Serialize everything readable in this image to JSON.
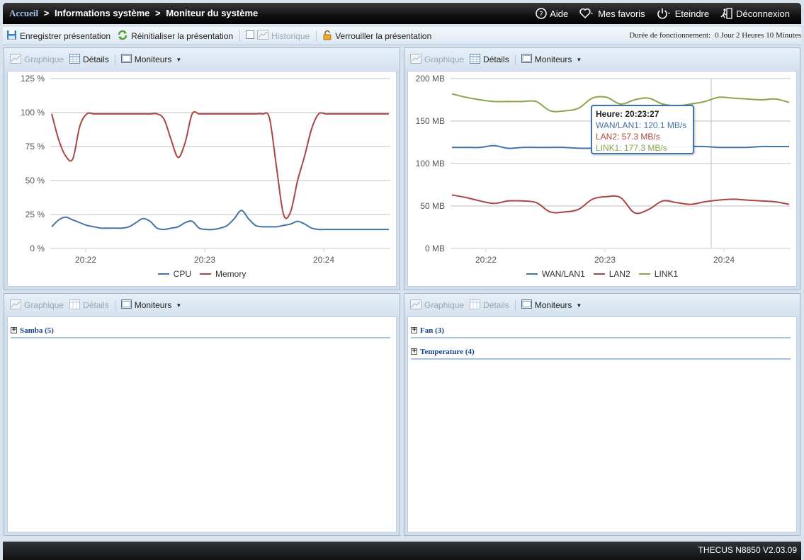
{
  "breadcrumb": {
    "home": "Accueil",
    "separator": ">",
    "section": "Informations système",
    "page": "Moniteur du système"
  },
  "topnav": {
    "help": "Aide",
    "favorites": "Mes favoris",
    "shutdown": "Eteindre",
    "logout": "Déconnexion"
  },
  "toolbar": {
    "save": "Enregistrer présentation",
    "reset": "Réinitialiser la présentation",
    "history": "Historique",
    "lock": "Verrouiller la présentation",
    "uptime_label": "Durée de fonctionnement:",
    "uptime_value": "0 Jour 2 Heures 10 Minutes"
  },
  "panel_toolbar": {
    "graph": "Graphique",
    "details": "Détails",
    "monitors": "Moniteurs"
  },
  "panels": {
    "bottom_left": {
      "groups": [
        {
          "label": "Samba (5)"
        }
      ]
    },
    "bottom_right": {
      "groups": [
        {
          "label": "Fan (3)"
        },
        {
          "label": "Temperature (4)"
        }
      ]
    }
  },
  "tooltip": {
    "title": "Heure: 20:23:27",
    "lines": [
      {
        "text": "WAN/LAN1: 120.1 MB/s",
        "color": "#4572a7"
      },
      {
        "text": "LAN2: 57.3 MB/s",
        "color": "#aa4643"
      },
      {
        "text": "LINK1: 177.3 MB/s",
        "color": "#89a54e"
      }
    ]
  },
  "chart_data": [
    {
      "type": "line",
      "x_ticks": [
        "20:22",
        "20:23",
        "20:24"
      ],
      "y_ticks": [
        "0 %",
        "25 %",
        "50 %",
        "75 %",
        "100 %",
        "125 %"
      ],
      "ylim": [
        0,
        125
      ],
      "grid": true,
      "legend": "bottom",
      "series": [
        {
          "name": "CPU",
          "color": "#4572a7",
          "x": [
            0,
            10,
            20,
            30,
            40,
            50,
            60,
            70,
            80,
            90,
            100,
            110,
            120,
            130,
            140,
            150,
            160,
            170,
            180,
            190,
            200,
            210,
            220,
            230,
            240,
            250,
            260,
            270,
            280,
            290,
            300,
            310,
            320,
            330,
            340,
            350,
            360,
            370,
            380,
            390,
            400,
            410,
            420,
            430,
            440,
            450,
            460,
            470,
            480
          ],
          "values": [
            16,
            21,
            23,
            21,
            19,
            17,
            16,
            15,
            15,
            15,
            15,
            16,
            19,
            22,
            20,
            15,
            14,
            15,
            16,
            19,
            20,
            15,
            14,
            14,
            15,
            17,
            22,
            28,
            22,
            17,
            16,
            16,
            16,
            17,
            18,
            20,
            18,
            15,
            14,
            14,
            14,
            14,
            14,
            14,
            14,
            14,
            14,
            14,
            14
          ]
        },
        {
          "name": "Memory",
          "color": "#aa4643",
          "x": [
            0,
            10,
            20,
            30,
            40,
            50,
            60,
            70,
            80,
            90,
            100,
            110,
            120,
            130,
            140,
            150,
            160,
            170,
            180,
            190,
            200,
            210,
            220,
            230,
            240,
            250,
            260,
            270,
            280,
            290,
            300,
            310,
            320,
            330,
            340,
            350,
            360,
            370,
            380,
            390,
            400,
            410,
            420,
            430,
            440,
            450,
            460,
            470,
            480
          ],
          "values": [
            99,
            80,
            68,
            66,
            90,
            99,
            99,
            99,
            99,
            99,
            99,
            99,
            99,
            99,
            99,
            99,
            95,
            80,
            67,
            78,
            99,
            99,
            99,
            99,
            99,
            99,
            99,
            99,
            99,
            99,
            99,
            96,
            60,
            25,
            27,
            50,
            68,
            88,
            99,
            99,
            99,
            99,
            99,
            99,
            99,
            99,
            99,
            99,
            99
          ]
        }
      ]
    },
    {
      "type": "line",
      "x_ticks": [
        "20:22",
        "20:23",
        "20:24"
      ],
      "y_ticks": [
        "0 MB",
        "50 MB",
        "100 MB",
        "150 MB",
        "200 MB"
      ],
      "ylim": [
        0,
        200
      ],
      "grid": true,
      "legend": "bottom",
      "series": [
        {
          "name": "WAN/LAN1",
          "color": "#4572a7",
          "x": [
            0,
            20,
            40,
            60,
            80,
            100,
            120,
            140,
            160,
            180,
            200,
            220,
            240,
            260,
            280,
            300,
            320,
            340,
            360,
            380,
            400,
            420,
            440,
            460,
            480
          ],
          "values": [
            119,
            119,
            119,
            121,
            118,
            119,
            119,
            119,
            119,
            118,
            118,
            118,
            118,
            119,
            118,
            119,
            119,
            120,
            120,
            119,
            119,
            119,
            120,
            120,
            120
          ]
        },
        {
          "name": "LAN2",
          "color": "#aa4643",
          "x": [
            0,
            20,
            40,
            60,
            80,
            100,
            120,
            140,
            160,
            180,
            200,
            220,
            240,
            260,
            280,
            300,
            320,
            340,
            360,
            380,
            400,
            420,
            440,
            460,
            480
          ],
          "values": [
            63,
            60,
            56,
            53,
            56,
            56,
            54,
            43,
            43,
            46,
            58,
            61,
            60,
            42,
            46,
            56,
            54,
            52,
            55,
            57,
            58,
            57,
            56,
            55,
            52
          ]
        },
        {
          "name": "LINK1",
          "color": "#89a54e",
          "x": [
            0,
            20,
            40,
            60,
            80,
            100,
            120,
            140,
            160,
            180,
            200,
            220,
            240,
            260,
            280,
            300,
            320,
            340,
            360,
            380,
            400,
            420,
            440,
            460,
            480
          ],
          "values": [
            182,
            178,
            175,
            173,
            173,
            173,
            173,
            162,
            162,
            165,
            177,
            178,
            170,
            175,
            177,
            170,
            168,
            170,
            173,
            178,
            177,
            176,
            175,
            176,
            172
          ]
        }
      ]
    }
  ],
  "footer": {
    "version": "THECUS N8850 V2.03.09"
  }
}
